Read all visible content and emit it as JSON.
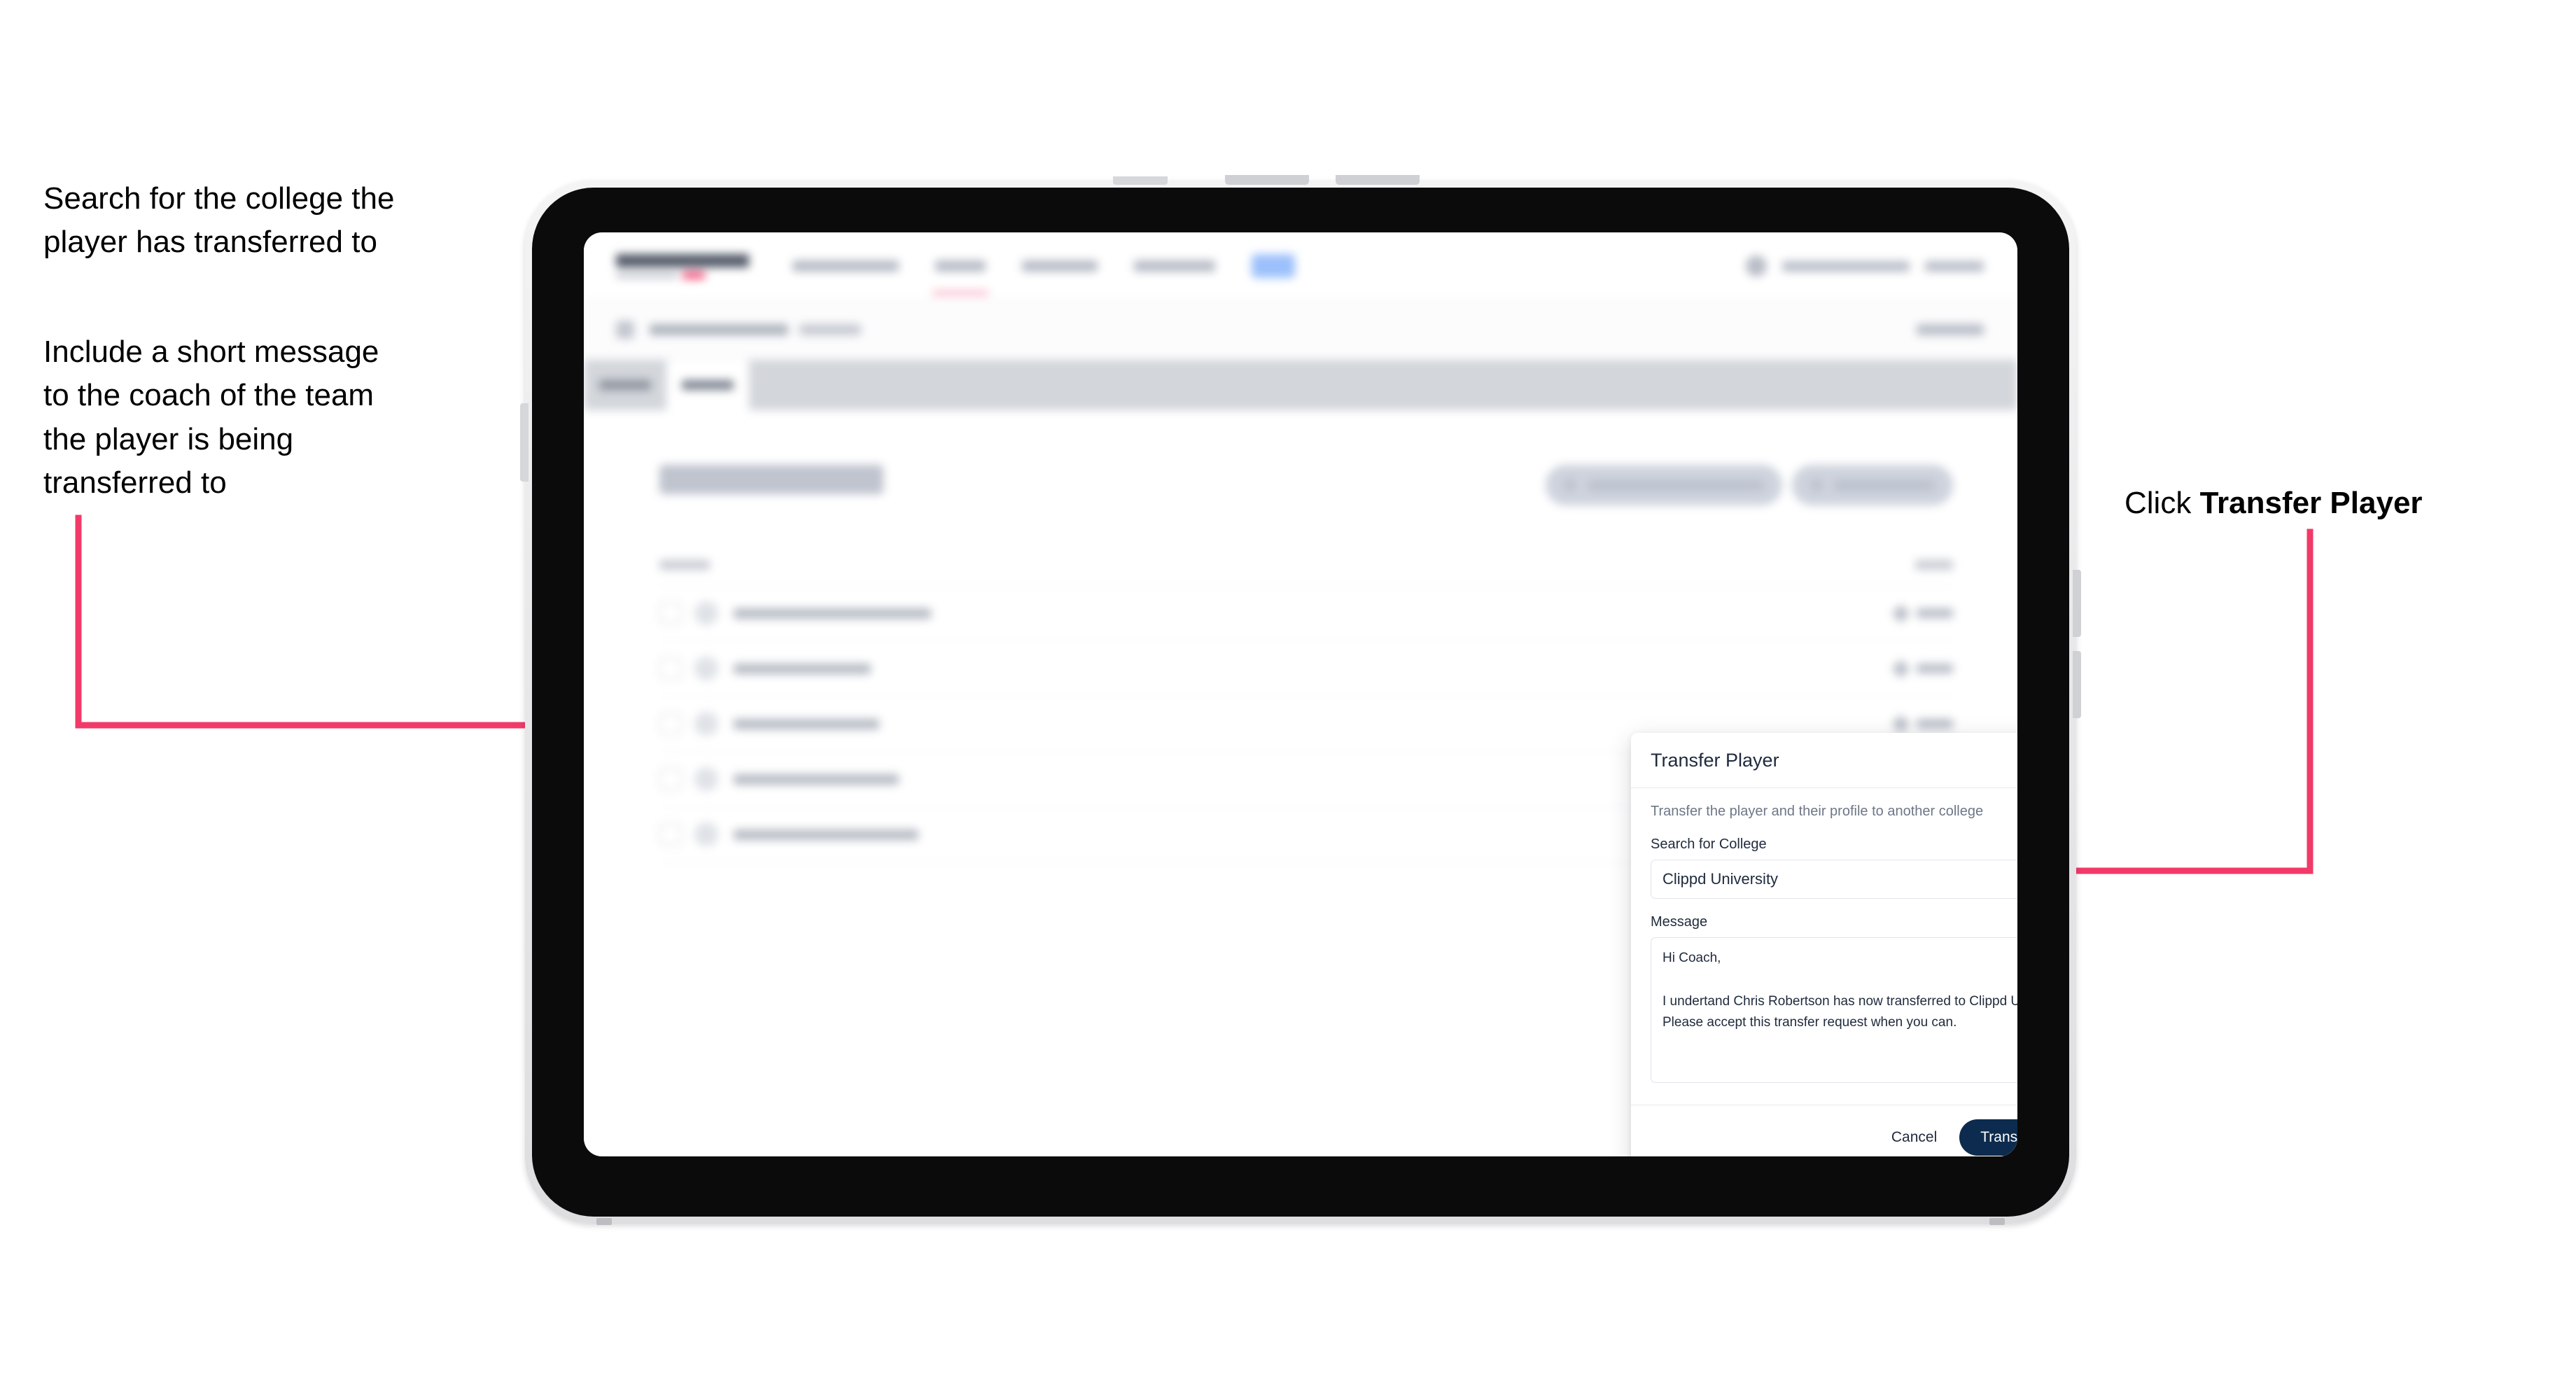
{
  "annotations": {
    "left_1": "Search for the college the\nplayer has transferred to",
    "left_2": "Include a short message\nto the coach of the team\nthe player is being\ntransferred to",
    "right_prefix": "Click ",
    "right_bold": "Transfer Player"
  },
  "colors": {
    "arrow_pink": "#F23A69",
    "primary_navy": "#0D2B4E",
    "text_dark": "#1F2A3C",
    "muted": "#6D7787",
    "border": "#DFE3EA"
  },
  "modal": {
    "title": "Transfer Player",
    "close_icon": "close-icon",
    "description": "Transfer the player and their profile to another college",
    "college_label": "Search for College",
    "college_value": "Clippd University",
    "college_placeholder": "Search for College",
    "message_label": "Message",
    "message_value": "Hi Coach,\n\nI undertand Chris Robertson has now transferred to Clippd University.\nPlease accept this transfer request when you can.",
    "message_placeholder": "Message",
    "cancel_label": "Cancel",
    "submit_label": "Transfer Player"
  },
  "app": {
    "nav_item_count": 4,
    "nav_badge": true,
    "roster_row_count": 5,
    "header_button_count": 2
  }
}
